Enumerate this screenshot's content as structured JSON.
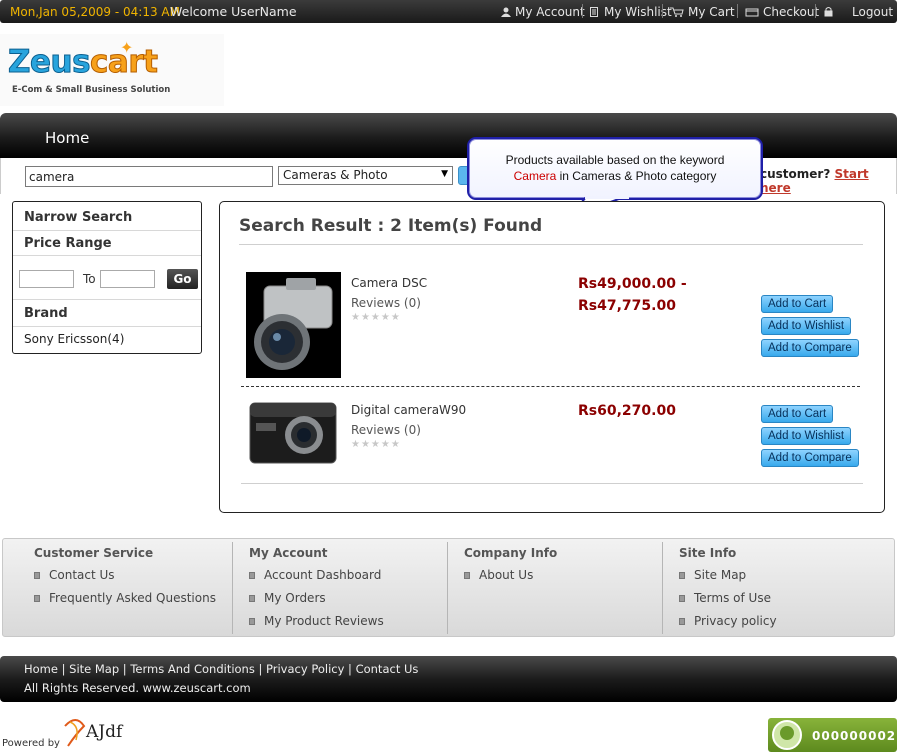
{
  "topbar": {
    "date": "Mon,Jan 05,2009 - 04:13 AM",
    "welcome": "Welcome UserName",
    "links": {
      "my_account": "My Account",
      "my_wishlist": "My Wishlist",
      "my_cart": "My Cart",
      "checkout": "Checkout",
      "logout": "Logout"
    }
  },
  "logo": {
    "word_a": "Zeus",
    "word_b": "cart",
    "tagline": "E-Com & Small Business Solution"
  },
  "nav": {
    "home": "Home"
  },
  "search": {
    "value": "camera",
    "category": "Cameras & Photo",
    "new_customer": "customer?",
    "start_here": "Start here"
  },
  "callout": {
    "line1": "Products available based on the keyword",
    "keyword": "Camera",
    "line2_rest": " in Cameras & Photo category"
  },
  "sidebar": {
    "narrow": "Narrow Search",
    "price_range": "Price Range",
    "to": "To",
    "go": "Go",
    "brand": "Brand",
    "brand_item": "Sony Ericsson(4)"
  },
  "results": {
    "title": "Search Result : 2 Item(s) Found",
    "products": [
      {
        "name": "Camera DSC",
        "reviews": "Reviews (0)",
        "price_line1": "Rs49,000.00 -",
        "price_line2": "Rs47,775.00"
      },
      {
        "name": "Digital cameraW90",
        "reviews": "Reviews (0)",
        "price_line1": "Rs60,270.00"
      }
    ],
    "buttons": {
      "add_to_cart": "Add to Cart",
      "add_to_wishlist": "Add to Wishlist",
      "add_to_compare": "Add to Compare"
    }
  },
  "footer": {
    "customer_service": {
      "head": "Customer Service",
      "links": [
        "Contact Us",
        "Frequently Asked Questions"
      ]
    },
    "my_account": {
      "head": "My Account",
      "links": [
        "Account Dashboard",
        "My Orders",
        "My Product Reviews"
      ]
    },
    "company_info": {
      "head": "Company Info",
      "links": [
        "About Us"
      ]
    },
    "site_info": {
      "head": "Site Info",
      "links": [
        "Site Map",
        "Terms of Use",
        "Privacy policy"
      ]
    }
  },
  "bottom": {
    "links": "Home | Site Map | Terms And Conditions | Privacy Policy | Contact Us",
    "copyright": "All Rights Reserved. www.zeuscart.com",
    "powered": "Powered by",
    "ajdf": "AJdf",
    "counter": "000000002"
  },
  "colors": {
    "accent_blue": "#38a9ec",
    "price_red": "#8b0000",
    "date_orange": "#f0b400",
    "callout_border": "#1f1fa8"
  }
}
